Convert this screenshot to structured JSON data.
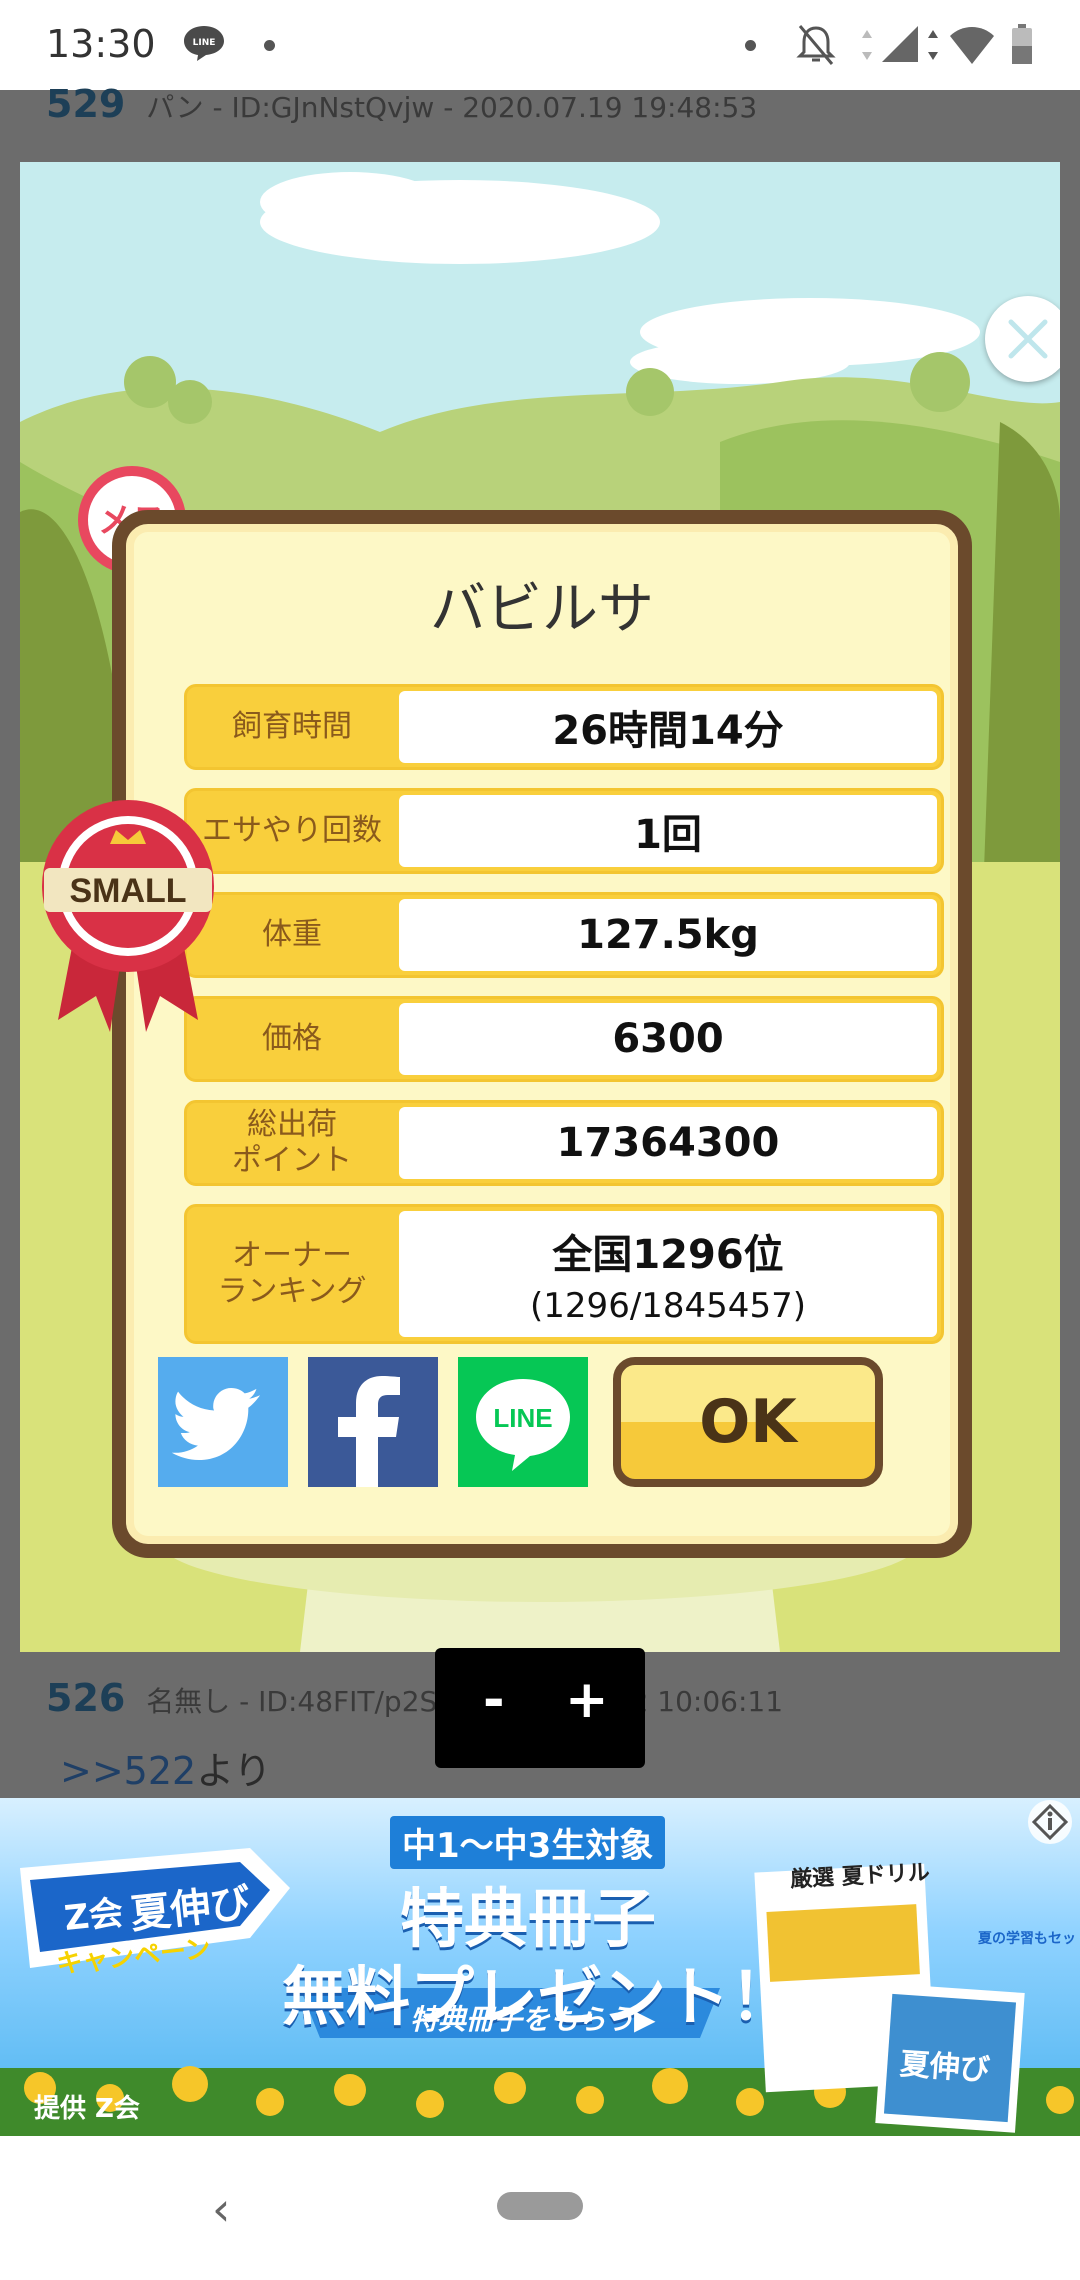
{
  "status_bar": {
    "time": "13:30",
    "line_badge": "LINE"
  },
  "forum": {
    "post_529": {
      "number": "529",
      "meta": "パン - ID:GJnNstQvjw - 2020.07.19 19:48:53"
    },
    "post_526": {
      "number": "526",
      "meta": "名無し - ID:48FIT/p2Sw - 2020.07.22 10:06:11"
    },
    "post_body": {
      "ref": ">>522",
      "text": "より"
    }
  },
  "game": {
    "gender_badge": "メス",
    "size_badge": "SMALL",
    "pig_name": "バビルサ",
    "stats": [
      {
        "label": "飼育時間",
        "value": "26時間14分"
      },
      {
        "label": "エサやり回数",
        "value": "1回"
      },
      {
        "label": "体重",
        "value": "127.5kg"
      },
      {
        "label": "価格",
        "value": "6300"
      },
      {
        "label": "総出荷\nポイント",
        "value": "17364300"
      },
      {
        "label": "オーナー\nランキング",
        "value": "全国1296位",
        "sub": "(1296/1845457)"
      }
    ],
    "share": {
      "line_label": "LINE"
    },
    "ok_label": "OK"
  },
  "zoom": {
    "minus": "-",
    "plus": "+"
  },
  "ad": {
    "target": "中1〜中3生対象",
    "headline": "特典冊子",
    "headline2": "無料プレゼント！",
    "campaign_brand": "Z会",
    "campaign_name": "夏伸び",
    "campaign_sub": "キャンペーン",
    "cta": "特典冊子をもらう▶",
    "provider": "提供 Z会",
    "book_title": "厳選 夏ドリル",
    "book_tag": "夏の学習もセット",
    "book2_title": "夏伸び"
  },
  "colors": {
    "card_border": "#6b4a2c",
    "card_bg": "#fdf8c6",
    "stat_label_bg": "#f9cf3c",
    "twitter": "#55acee",
    "facebook": "#3b5998",
    "line": "#06c755"
  }
}
